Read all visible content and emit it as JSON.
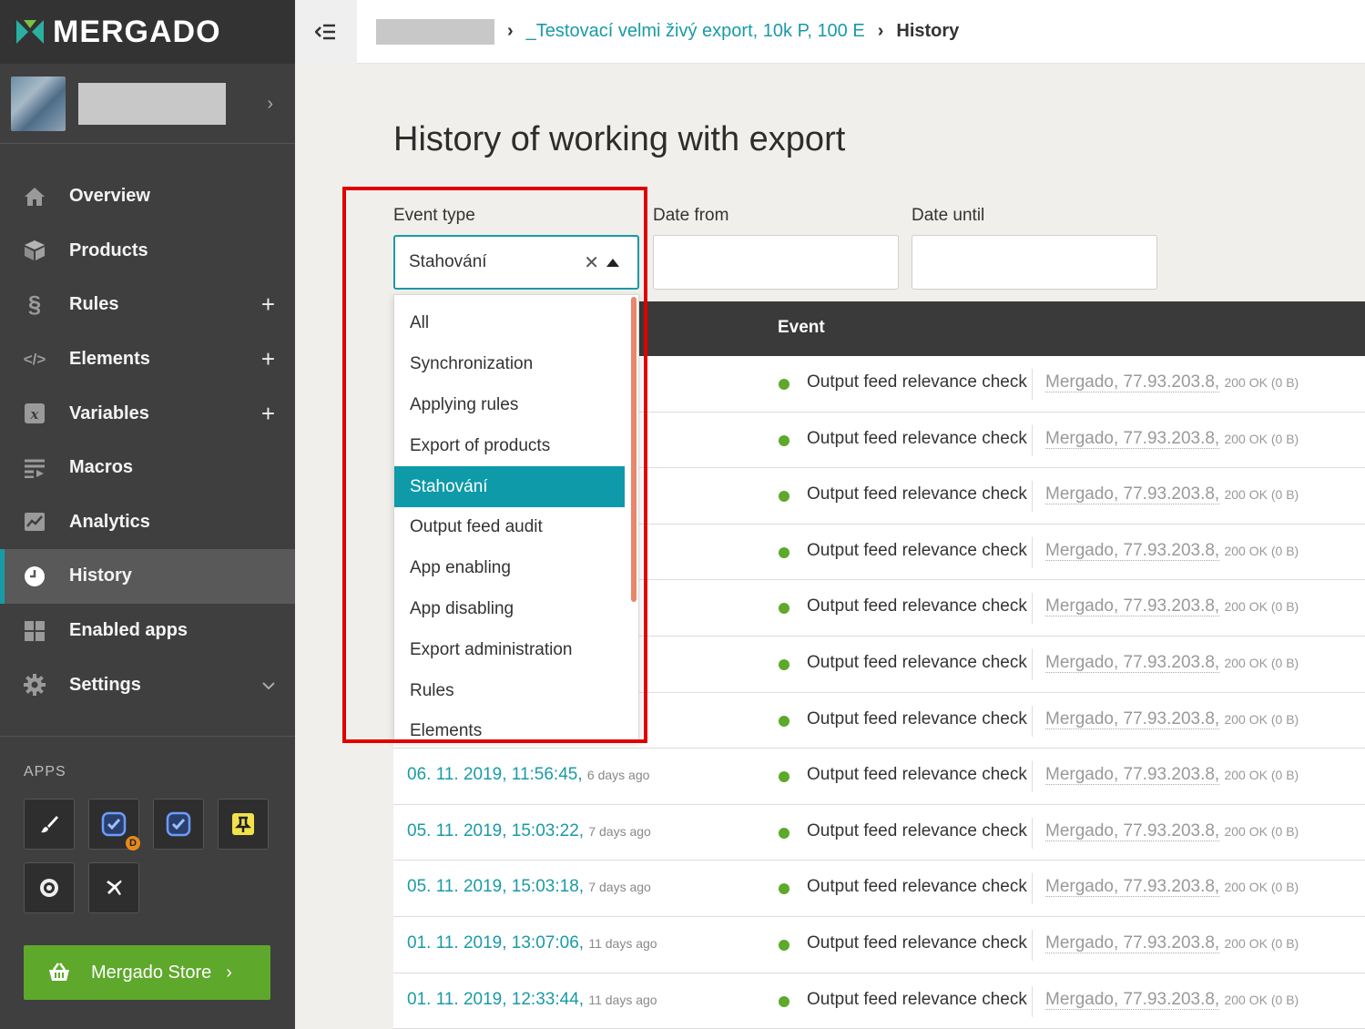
{
  "sidebar": {
    "brand": "MERGADO",
    "nav": [
      {
        "label": "Overview",
        "icon": "home-icon",
        "extra": ""
      },
      {
        "label": "Products",
        "icon": "box-icon",
        "extra": ""
      },
      {
        "label": "Rules",
        "icon": "paragraph-icon",
        "extra": "+"
      },
      {
        "label": "Elements",
        "icon": "code-icon",
        "extra": "+"
      },
      {
        "label": "Variables",
        "icon": "variable-icon",
        "extra": "+"
      },
      {
        "label": "Macros",
        "icon": "macro-icon",
        "extra": ""
      },
      {
        "label": "Analytics",
        "icon": "chart-icon",
        "extra": ""
      },
      {
        "label": "History",
        "icon": "clock-icon",
        "extra": "",
        "active": true
      },
      {
        "label": "Enabled apps",
        "icon": "grid-icon",
        "extra": ""
      },
      {
        "label": "Settings",
        "icon": "gear-icon",
        "extra": "v"
      }
    ],
    "apps_title": "APPS",
    "app_badge": "D",
    "store_label": "Mergado Store"
  },
  "breadcrumb": {
    "export_name": "_Testovací velmi živý export, 10k P, 100 E",
    "current": "History"
  },
  "page_title": "History of working with export",
  "filters": {
    "event_type_label": "Event type",
    "event_type_value": "Stahování",
    "date_from_label": "Date from",
    "date_until_label": "Date until"
  },
  "dropdown_options": [
    "All",
    "Synchronization",
    "Applying rules",
    "Export of products",
    "Stahování",
    "Output feed audit",
    "App enabling",
    "App disabling",
    "Export administration",
    "Rules",
    "Elements"
  ],
  "table": {
    "event_header": "Event",
    "rows": [
      {
        "date": "",
        "ago": "",
        "event": "Output feed relevance check",
        "source": "Mergado, 77.93.203.8,",
        "status": "200 OK (0 B)"
      },
      {
        "date": "",
        "ago": "",
        "event": "Output feed relevance check",
        "source": "Mergado, 77.93.203.8,",
        "status": "200 OK (0 B)"
      },
      {
        "date": "",
        "ago": "",
        "event": "Output feed relevance check",
        "source": "Mergado, 77.93.203.8,",
        "status": "200 OK (0 B)"
      },
      {
        "date": "",
        "ago": "",
        "event": "Output feed relevance check",
        "source": "Mergado, 77.93.203.8,",
        "status": "200 OK (0 B)"
      },
      {
        "date": "",
        "ago": "",
        "event": "Output feed relevance check",
        "source": "Mergado, 77.93.203.8,",
        "status": "200 OK (0 B)"
      },
      {
        "date": "",
        "ago": "",
        "event": "Output feed relevance check",
        "source": "Mergado, 77.93.203.8,",
        "status": "200 OK (0 B)"
      },
      {
        "date": "",
        "ago": "",
        "event": "Output feed relevance check",
        "source": "Mergado, 77.93.203.8,",
        "status": "200 OK (0 B)"
      },
      {
        "date": "06. 11. 2019, 11:56:45,",
        "ago": "6 days ago",
        "event": "Output feed relevance check",
        "source": "Mergado, 77.93.203.8,",
        "status": "200 OK (0 B)"
      },
      {
        "date": "05. 11. 2019, 15:03:22,",
        "ago": "7 days ago",
        "event": "Output feed relevance check",
        "source": "Mergado, 77.93.203.8,",
        "status": "200 OK (0 B)"
      },
      {
        "date": "05. 11. 2019, 15:03:18,",
        "ago": "7 days ago",
        "event": "Output feed relevance check",
        "source": "Mergado, 77.93.203.8,",
        "status": "200 OK (0 B)"
      },
      {
        "date": "01. 11. 2019, 13:07:06,",
        "ago": "11 days ago",
        "event": "Output feed relevance check",
        "source": "Mergado, 77.93.203.8,",
        "status": "200 OK (0 B)"
      },
      {
        "date": "01. 11. 2019, 12:33:44,",
        "ago": "11 days ago",
        "event": "Output feed relevance check",
        "source": "Mergado, 77.93.203.8,",
        "status": "200 OK (0 B)"
      }
    ]
  },
  "colors": {
    "accent": "#199aa7",
    "store": "#5ea82b",
    "highlight": "#e00000",
    "selected_option": "#0e9aa8"
  }
}
